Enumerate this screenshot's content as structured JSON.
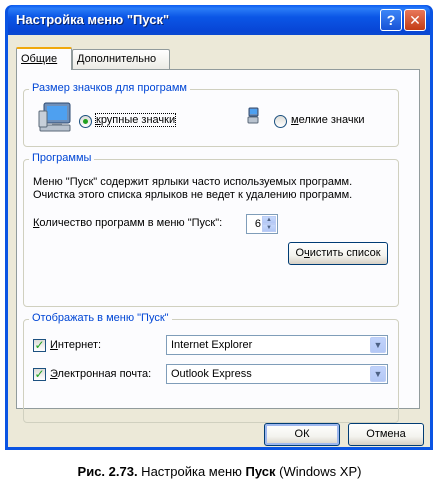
{
  "window": {
    "title": "Настройка меню \"Пуск\""
  },
  "titlebar": {
    "help_label": "?",
    "close_label": "✕"
  },
  "tabs": [
    {
      "label": "Общие"
    },
    {
      "label_ul": "Д",
      "label_rest": "ополнительно"
    }
  ],
  "icon_size_group": {
    "title": "Размер значков для программ",
    "large_label_ul": "к",
    "large_label_rest": "рупные значки",
    "large_selected": true,
    "small_label_pre": "",
    "small_label_ul": "м",
    "small_label_rest": "елкие значки",
    "small_selected": false
  },
  "programs_group": {
    "title": "Программы",
    "desc_line1": "Меню \"Пуск\" содержит ярлыки часто используемых программ.",
    "desc_line2": "Очистка этого списка ярлыков не ведет к удалению программ.",
    "count_label_ul": "К",
    "count_label_rest": "оличество программ в меню \"Пуск\":",
    "count_value": "6",
    "clear_button_pre": "О",
    "clear_button_ul": "ч",
    "clear_button_rest": "истить список"
  },
  "show_group": {
    "title": "Отображать в меню \"Пуск\"",
    "internet_checked": true,
    "internet_label_ul": "И",
    "internet_label_rest": "нтернет:",
    "internet_value": "Internet Explorer",
    "email_checked": true,
    "email_label_ul": "Э",
    "email_label_rest": "лектронная почта:",
    "email_value": "Outlook Express"
  },
  "footer": {
    "ok_label": "ОК",
    "cancel_label": "Отмена"
  },
  "caption": {
    "prefix": "Рис. 2.73.",
    "text1": " Настройка меню ",
    "bold": "Пуск",
    "text2": " (Windows XP)"
  }
}
